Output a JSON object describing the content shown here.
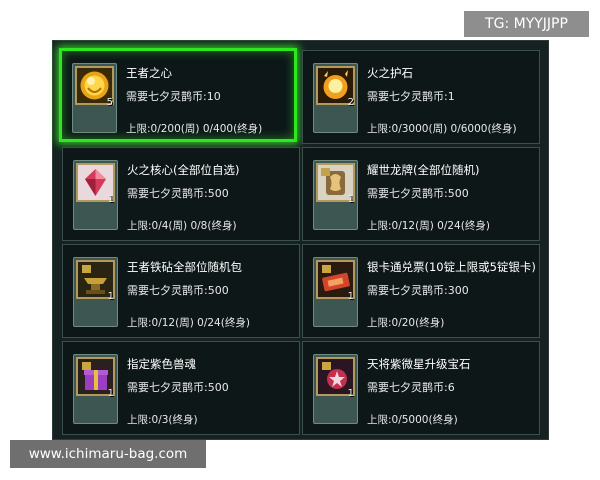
{
  "overlay_tag": "TG: MYYJJPP",
  "watermark": "www.ichimaru-bag.com",
  "accent_color": "#2de81e",
  "items": [
    {
      "name": "王者之心",
      "cost": "需要七夕灵鹊币:10",
      "limit": "上限:0/200(周) 0/400(终身)",
      "qty": "5",
      "icon": "golden-heart-icon",
      "selected": true
    },
    {
      "name": "火之护石",
      "cost": "需要七夕灵鹊币:1",
      "limit": "上限:0/3000(周) 0/6000(终身)",
      "qty": "2",
      "icon": "fire-stone-icon",
      "selected": false
    },
    {
      "name": "火之核心(全部位自选)",
      "cost": "需要七夕灵鹊币:500",
      "limit": "上限:0/4(周) 0/8(终身)",
      "qty": "1",
      "icon": "fire-core-crystal-icon",
      "selected": false
    },
    {
      "name": "耀世龙牌(全部位随机)",
      "cost": "需要七夕灵鹊币:500",
      "limit": "上限:0/12(周) 0/24(终身)",
      "qty": "1",
      "icon": "dragon-plate-icon",
      "selected": false
    },
    {
      "name": "王者铁砧全部位随机包",
      "cost": "需要七夕灵鹊币:500",
      "limit": "上限:0/12(周) 0/24(终身)",
      "qty": "1",
      "icon": "anvil-pack-icon",
      "selected": false
    },
    {
      "name": "银卡通兑票(10锭上限或5锭银卡)",
      "cost": "需要七夕灵鹊币:300",
      "limit": "上限:0/20(终身)",
      "qty": "1",
      "icon": "ticket-icon",
      "selected": false
    },
    {
      "name": "指定紫色兽魂",
      "cost": "需要七夕灵鹊币:500",
      "limit": "上限:0/3(终身)",
      "qty": "1",
      "icon": "purple-gift-box-icon",
      "selected": false
    },
    {
      "name": "天将紫微星升级宝石",
      "cost": "需要七夕灵鹊币:6",
      "limit": "上限:0/5000(终身)",
      "qty": "1",
      "icon": "purple-star-gem-icon",
      "selected": false
    }
  ]
}
